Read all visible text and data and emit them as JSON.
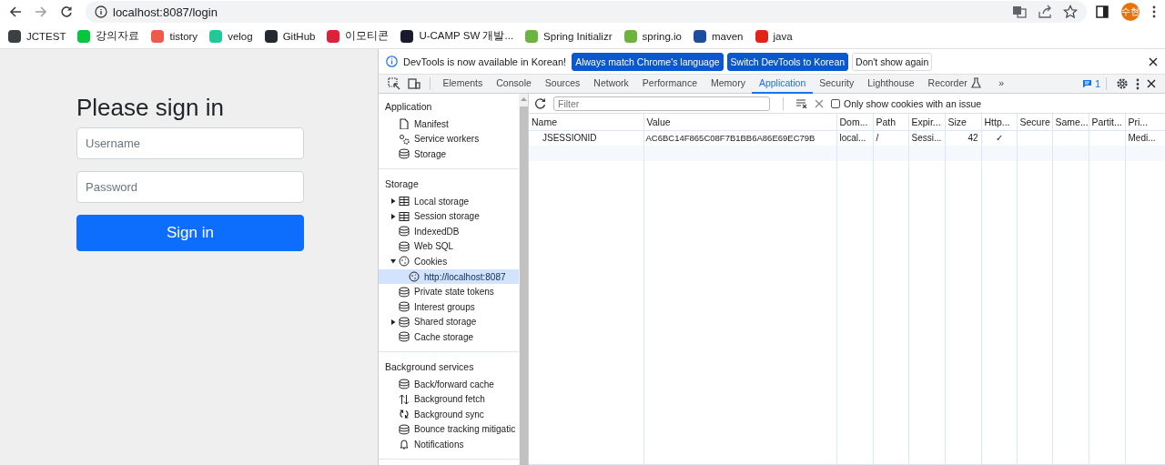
{
  "browser": {
    "url": "localhost:8087/login",
    "profile": "수현"
  },
  "bookmarks": [
    {
      "label": "JCTEST",
      "color": "#3c4043"
    },
    {
      "label": "강의자료",
      "color": "#00c73c"
    },
    {
      "label": "tistory",
      "color": "#f0584a"
    },
    {
      "label": "velog",
      "color": "#20c997"
    },
    {
      "label": "GitHub",
      "color": "#24292f"
    },
    {
      "label": "이모티콘",
      "color": "#e0203a"
    },
    {
      "label": "U-CAMP SW 개발...",
      "color": "#1a1a2e"
    },
    {
      "label": "Spring Initializr",
      "color": "#6db33f"
    },
    {
      "label": "spring.io",
      "color": "#6db33f"
    },
    {
      "label": "maven",
      "color": "#1f4e9c"
    },
    {
      "label": "java",
      "color": "#e2231a"
    }
  ],
  "login": {
    "heading": "Please sign in",
    "username": {
      "placeholder": "Username"
    },
    "password": {
      "placeholder": "Password"
    },
    "submit": "Sign in"
  },
  "devtools": {
    "infobar": {
      "message": "DevTools is now available in Korean!",
      "buttons": [
        {
          "label": "Always match Chrome's language",
          "kind": "primary"
        },
        {
          "label": "Switch DevTools to Korean",
          "kind": "primary"
        },
        {
          "label": "Don't show again",
          "kind": "plain"
        }
      ]
    },
    "tabs": [
      {
        "label": "Elements",
        "selected": false
      },
      {
        "label": "Console",
        "selected": false
      },
      {
        "label": "Sources",
        "selected": false
      },
      {
        "label": "Network",
        "selected": false
      },
      {
        "label": "Performance",
        "selected": false
      },
      {
        "label": "Memory",
        "selected": false
      },
      {
        "label": "Application",
        "selected": true
      },
      {
        "label": "Security",
        "selected": false
      },
      {
        "label": "Lighthouse",
        "selected": false
      },
      {
        "label": "Recorder",
        "selected": false
      }
    ],
    "more_tabs": "»",
    "issues_count": "1",
    "sidebar": [
      {
        "title": "Application",
        "items": [
          {
            "label": "Manifest",
            "kind": "file"
          },
          {
            "label": "Service workers",
            "kind": "gears"
          },
          {
            "label": "Storage",
            "kind": "database"
          }
        ]
      },
      {
        "title": "Storage",
        "items": [
          {
            "label": "Local storage",
            "kind": "table",
            "expanded": false
          },
          {
            "label": "Session storage",
            "kind": "table",
            "expanded": false
          },
          {
            "label": "IndexedDB",
            "kind": "database"
          },
          {
            "label": "Web SQL",
            "kind": "database"
          },
          {
            "label": "Cookies",
            "kind": "cookie",
            "expanded": true,
            "children": [
              {
                "label": "http://localhost:8087",
                "kind": "cookie",
                "selected": true
              }
            ]
          },
          {
            "label": "Private state tokens",
            "kind": "database"
          },
          {
            "label": "Interest groups",
            "kind": "database"
          },
          {
            "label": "Shared storage",
            "kind": "database",
            "expanded": false
          },
          {
            "label": "Cache storage",
            "kind": "database"
          }
        ]
      },
      {
        "title": "Background services",
        "items": [
          {
            "label": "Back/forward cache",
            "kind": "database"
          },
          {
            "label": "Background fetch",
            "kind": "arrows"
          },
          {
            "label": "Background sync",
            "kind": "sync"
          },
          {
            "label": "Bounce tracking mitigatic",
            "kind": "database"
          },
          {
            "label": "Notifications",
            "kind": "bell"
          }
        ]
      }
    ],
    "cookies": {
      "filter": {
        "placeholder": "Filter"
      },
      "only_issues": {
        "label": "Only show cookies with an issue",
        "checked": false
      },
      "table": {
        "columns": [
          "Name",
          "Value",
          "Dom...",
          "Path",
          "Expir...",
          "Size",
          "Http...",
          "Secure",
          "Same...",
          "Partit...",
          "Pri..."
        ],
        "rows": [
          {
            "cells": [
              "JSESSIONID",
              "AC6BC14F865C08F7B1BB6A86E69EC79B",
              "local...",
              "/",
              "Sessi...",
              "42",
              "✓",
              "",
              "",
              "",
              "Medi..."
            ]
          }
        ]
      }
    }
  }
}
